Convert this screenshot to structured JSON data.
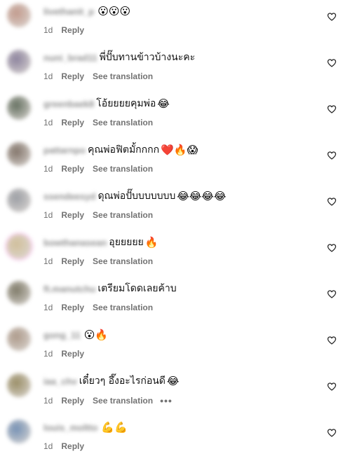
{
  "icons": {
    "like": "heart-outline-icon",
    "more": "more-dots-icon"
  },
  "comments": [
    {
      "username": "livethanit_p",
      "text": "",
      "emojis": "😮😮😮",
      "time": "1d",
      "reply": "Reply",
      "translation": "",
      "more": "",
      "avatar_color": "#b88a7a"
    },
    {
      "username": "nuni_brad11",
      "text": "พี่ปั๊บทานข้าวบ้างนะคะ",
      "emojis": "",
      "time": "1d",
      "reply": "Reply",
      "translation": "See translation",
      "more": "",
      "avatar_color": "#7a6f8e"
    },
    {
      "username": "greenbaek8",
      "text": "โอ้ยยยยคุมพ่อ",
      "emojis": "😂",
      "time": "1d",
      "reply": "Reply",
      "translation": "See translation",
      "more": "",
      "avatar_color": "#4d5a48"
    },
    {
      "username": "pattarnpo",
      "text": "คุณพ่อฟิตมั้กกกก",
      "emojis": "❤️🔥😱",
      "time": "1d",
      "reply": "Reply",
      "translation": "See translation",
      "more": "",
      "avatar_color": "#6e5e52"
    },
    {
      "username": "ssendeesyd",
      "text": "ดุณพ่อปั๊บบบบบบบ",
      "emojis": "😂😂😂😂",
      "time": "1d",
      "reply": "Reply",
      "translation": "See translation",
      "more": "",
      "avatar_color": "#8c8f96"
    },
    {
      "username": "bowthanasean",
      "text": "อุยยยยย",
      "emojis": "🔥",
      "time": "1d",
      "reply": "Reply",
      "translation": "See translation",
      "more": "",
      "avatar_color": "#c9b48a"
    },
    {
      "username": "ft.manutchu",
      "text": "เตรียมโดดเลยค้าบ",
      "emojis": "",
      "time": "1d",
      "reply": "Reply",
      "translation": "See translation",
      "more": "",
      "avatar_color": "#6a6550"
    },
    {
      "username": "gong_11",
      "text": "",
      "emojis": "😮🔥",
      "time": "1d",
      "reply": "Reply",
      "translation": "",
      "more": "",
      "avatar_color": "#a08a78"
    },
    {
      "username": "iaa_chv",
      "text": "เดี๋ยวๆ อึ๊งอะไรก่อนดี",
      "emojis": "😂",
      "time": "1d",
      "reply": "Reply",
      "translation": "See translation",
      "more": "•••",
      "avatar_color": "#8a7c4e"
    },
    {
      "username": "louis_moltto",
      "text": "",
      "emojis": "💪💪",
      "time": "1d",
      "reply": "Reply",
      "translation": "",
      "more": "",
      "avatar_color": "#5f7fa8"
    }
  ]
}
